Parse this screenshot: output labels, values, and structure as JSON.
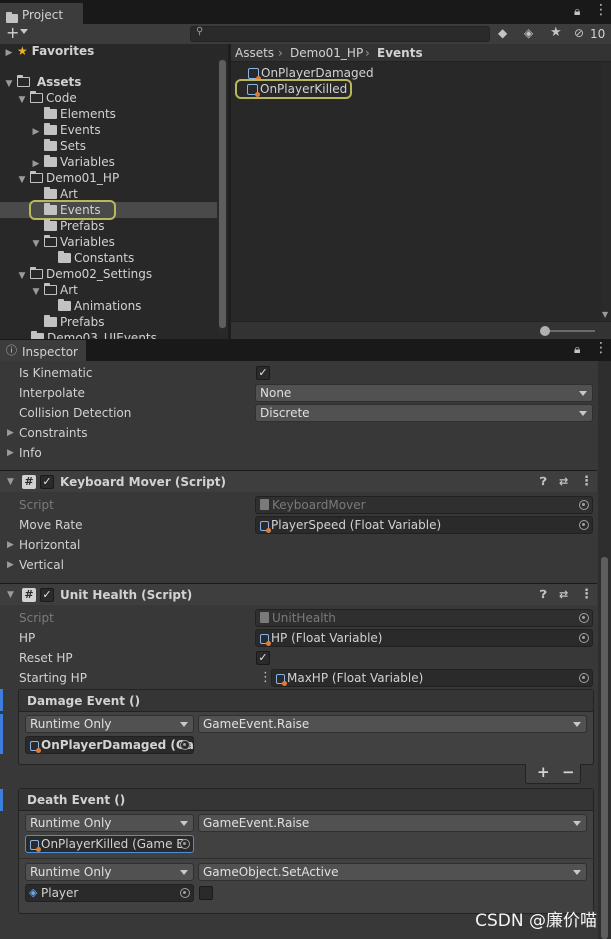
{
  "project_tab": {
    "title": "Project"
  },
  "project_toolbar": {
    "add_label": "+",
    "search_placeholder": "",
    "hidden_count": "10"
  },
  "tree": {
    "favorites": "Favorites",
    "assets": "Assets",
    "items": [
      {
        "label": "Code"
      },
      {
        "label": "Elements"
      },
      {
        "label": "Events"
      },
      {
        "label": "Sets"
      },
      {
        "label": "Variables"
      },
      {
        "label": "Demo01_HP"
      },
      {
        "label": "Art"
      },
      {
        "label": "Events"
      },
      {
        "label": "Prefabs"
      },
      {
        "label": "Variables"
      },
      {
        "label": "Constants"
      },
      {
        "label": "Demo02_Settings"
      },
      {
        "label": "Art"
      },
      {
        "label": "Animations"
      },
      {
        "label": "Prefabs"
      },
      {
        "label": "Demo03_UIEvents"
      }
    ]
  },
  "breadcrumb": {
    "part1": "Assets",
    "part2": "Demo01_HP",
    "part3": "Events"
  },
  "assets_list": [
    "OnPlayerDamaged",
    "OnPlayerKilled"
  ],
  "inspector_tab": {
    "title": "Inspector"
  },
  "rigidbody": {
    "is_kinematic": "Is Kinematic",
    "interpolate": "Interpolate",
    "interpolate_value": "None",
    "collision_detection": "Collision Detection",
    "collision_value": "Discrete",
    "constraints": "Constraints",
    "info": "Info"
  },
  "keyboard_mover": {
    "title": "Keyboard Mover (Script)",
    "script_label": "Script",
    "script_value": "KeyboardMover",
    "move_rate_label": "Move Rate",
    "move_rate_value": "PlayerSpeed (Float Variable)",
    "horizontal": "Horizontal",
    "vertical": "Vertical"
  },
  "unit_health": {
    "title": "Unit Health (Script)",
    "script_label": "Script",
    "script_value": "UnitHealth",
    "hp_label": "HP",
    "hp_value": "HP (Float Variable)",
    "reset_hp_label": "Reset HP",
    "starting_hp_label": "Starting HP",
    "starting_hp_value": "MaxHP (Float Variable)",
    "damage_event": {
      "title": "Damage Event ()",
      "mode": "Runtime Only",
      "function": "GameEvent.Raise",
      "target": "OnPlayerDamaged (Ga"
    },
    "death_event": {
      "title": "Death Event ()",
      "entry1_mode": "Runtime Only",
      "entry1_function": "GameEvent.Raise",
      "entry1_target": "OnPlayerKilled (Game E",
      "entry2_mode": "Runtime Only",
      "entry2_function": "GameObject.SetActive",
      "entry2_target": "Player"
    },
    "plus_label": "+",
    "minus_label": "−"
  },
  "watermark": "CSDN @廉价喵",
  "colors": {
    "accent_blue": "#3d7ddc",
    "highlight": "#b8b85a",
    "folder": "#c2c2c2"
  }
}
